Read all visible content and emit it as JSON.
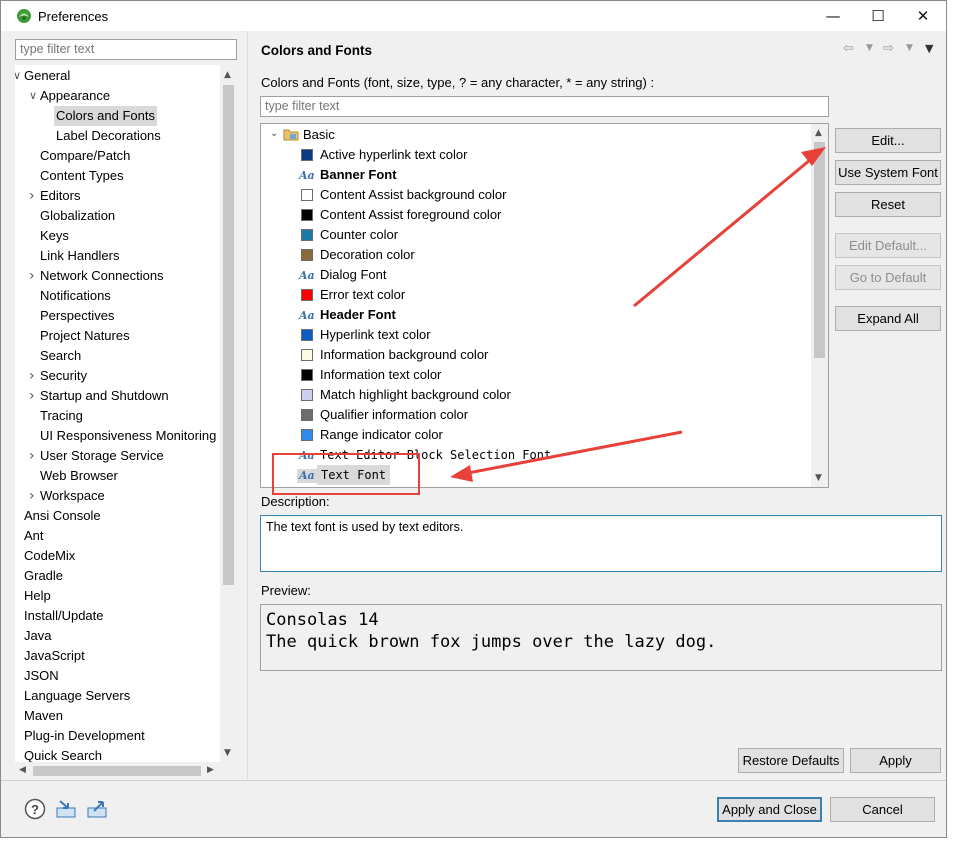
{
  "window": {
    "title": "Preferences",
    "minimize": "—",
    "maximize": "☐",
    "close": "✕"
  },
  "left": {
    "filter_placeholder": "type filter text",
    "tree": [
      {
        "label": "General",
        "level": 0,
        "expander": "open"
      },
      {
        "label": "Appearance",
        "level": 1,
        "expander": "open"
      },
      {
        "label": "Colors and Fonts",
        "level": 2,
        "expander": "none",
        "selected": true
      },
      {
        "label": "Label Decorations",
        "level": 2,
        "expander": "none"
      },
      {
        "label": "Compare/Patch",
        "level": 1,
        "expander": "none"
      },
      {
        "label": "Content Types",
        "level": 1,
        "expander": "none"
      },
      {
        "label": "Editors",
        "level": 1,
        "expander": "closed"
      },
      {
        "label": "Globalization",
        "level": 1,
        "expander": "none"
      },
      {
        "label": "Keys",
        "level": 1,
        "expander": "none"
      },
      {
        "label": "Link Handlers",
        "level": 1,
        "expander": "none"
      },
      {
        "label": "Network Connections",
        "level": 1,
        "expander": "closed"
      },
      {
        "label": "Notifications",
        "level": 1,
        "expander": "none"
      },
      {
        "label": "Perspectives",
        "level": 1,
        "expander": "none"
      },
      {
        "label": "Project Natures",
        "level": 1,
        "expander": "none"
      },
      {
        "label": "Search",
        "level": 1,
        "expander": "none"
      },
      {
        "label": "Security",
        "level": 1,
        "expander": "closed"
      },
      {
        "label": "Startup and Shutdown",
        "level": 1,
        "expander": "closed"
      },
      {
        "label": "Tracing",
        "level": 1,
        "expander": "none"
      },
      {
        "label": "UI Responsiveness Monitoring",
        "level": 1,
        "expander": "none"
      },
      {
        "label": "User Storage Service",
        "level": 1,
        "expander": "closed"
      },
      {
        "label": "Web Browser",
        "level": 1,
        "expander": "none"
      },
      {
        "label": "Workspace",
        "level": 1,
        "expander": "closed"
      },
      {
        "label": "Ansi Console",
        "level": 0,
        "expander": "none"
      },
      {
        "label": "Ant",
        "level": 0,
        "expander": "none"
      },
      {
        "label": "CodeMix",
        "level": 0,
        "expander": "none"
      },
      {
        "label": "Gradle",
        "level": 0,
        "expander": "none"
      },
      {
        "label": "Help",
        "level": 0,
        "expander": "none"
      },
      {
        "label": "Install/Update",
        "level": 0,
        "expander": "none"
      },
      {
        "label": "Java",
        "level": 0,
        "expander": "none"
      },
      {
        "label": "JavaScript",
        "level": 0,
        "expander": "none"
      },
      {
        "label": "JSON",
        "level": 0,
        "expander": "none"
      },
      {
        "label": "Language Servers",
        "level": 0,
        "expander": "none"
      },
      {
        "label": "Maven",
        "level": 0,
        "expander": "none"
      },
      {
        "label": "Plug-in Development",
        "level": 0,
        "expander": "none"
      },
      {
        "label": "Quick Search",
        "level": 0,
        "expander": "none"
      }
    ]
  },
  "right": {
    "title": "Colors and Fonts",
    "subtitle": "Colors and Fonts (font, size, type, ? = any character, * = any string) :",
    "filter_placeholder": "type filter text",
    "category": "Basic",
    "items": [
      {
        "label": "Active hyperlink text color",
        "kind": "color",
        "color": "#0b3a82"
      },
      {
        "label": "Banner Font",
        "kind": "font",
        "bold": true
      },
      {
        "label": "Content Assist background color",
        "kind": "color",
        "color": "#ffffff"
      },
      {
        "label": "Content Assist foreground color",
        "kind": "color",
        "color": "#000000"
      },
      {
        "label": "Counter color",
        "kind": "color",
        "color": "#1c7ba6"
      },
      {
        "label": "Decoration color",
        "kind": "color",
        "color": "#8b6a3a"
      },
      {
        "label": "Dialog Font",
        "kind": "font"
      },
      {
        "label": "Error text color",
        "kind": "color",
        "color": "#ff0000"
      },
      {
        "label": "Header Font",
        "kind": "font",
        "bold": true
      },
      {
        "label": "Hyperlink text color",
        "kind": "color",
        "color": "#0a5bc4"
      },
      {
        "label": "Information background color",
        "kind": "color",
        "color": "#fbfbe1"
      },
      {
        "label": "Information text color",
        "kind": "color",
        "color": "#000000"
      },
      {
        "label": "Match highlight background color",
        "kind": "color",
        "color": "#cfcfef"
      },
      {
        "label": "Qualifier information color",
        "kind": "color",
        "color": "#6d6d6d"
      },
      {
        "label": "Range indicator color",
        "kind": "color",
        "color": "#2f8be8"
      },
      {
        "label": "Text Editor Block Selection Font",
        "kind": "font",
        "mono": true
      },
      {
        "label": "Text Font",
        "kind": "font",
        "mono": true,
        "selected": true
      }
    ],
    "buttons": {
      "edit": "Edit...",
      "use_system_font": "Use System Font",
      "reset": "Reset",
      "edit_default": "Edit Default...",
      "go_to_default": "Go to Default",
      "expand_all": "Expand All"
    },
    "description_label": "Description:",
    "description": "The text font is used by text editors.",
    "preview_label": "Preview:",
    "preview_line1": "Consolas 14",
    "preview_line2": "The quick brown fox jumps over the lazy dog.",
    "restore_defaults": "Restore Defaults",
    "apply": "Apply"
  },
  "footer": {
    "apply_close": "Apply and Close",
    "cancel": "Cancel",
    "icons": [
      "help-icon",
      "import-icon",
      "export-icon"
    ]
  },
  "colors": {
    "accent": "#3c7fb1",
    "annotation": "#e8413a"
  }
}
